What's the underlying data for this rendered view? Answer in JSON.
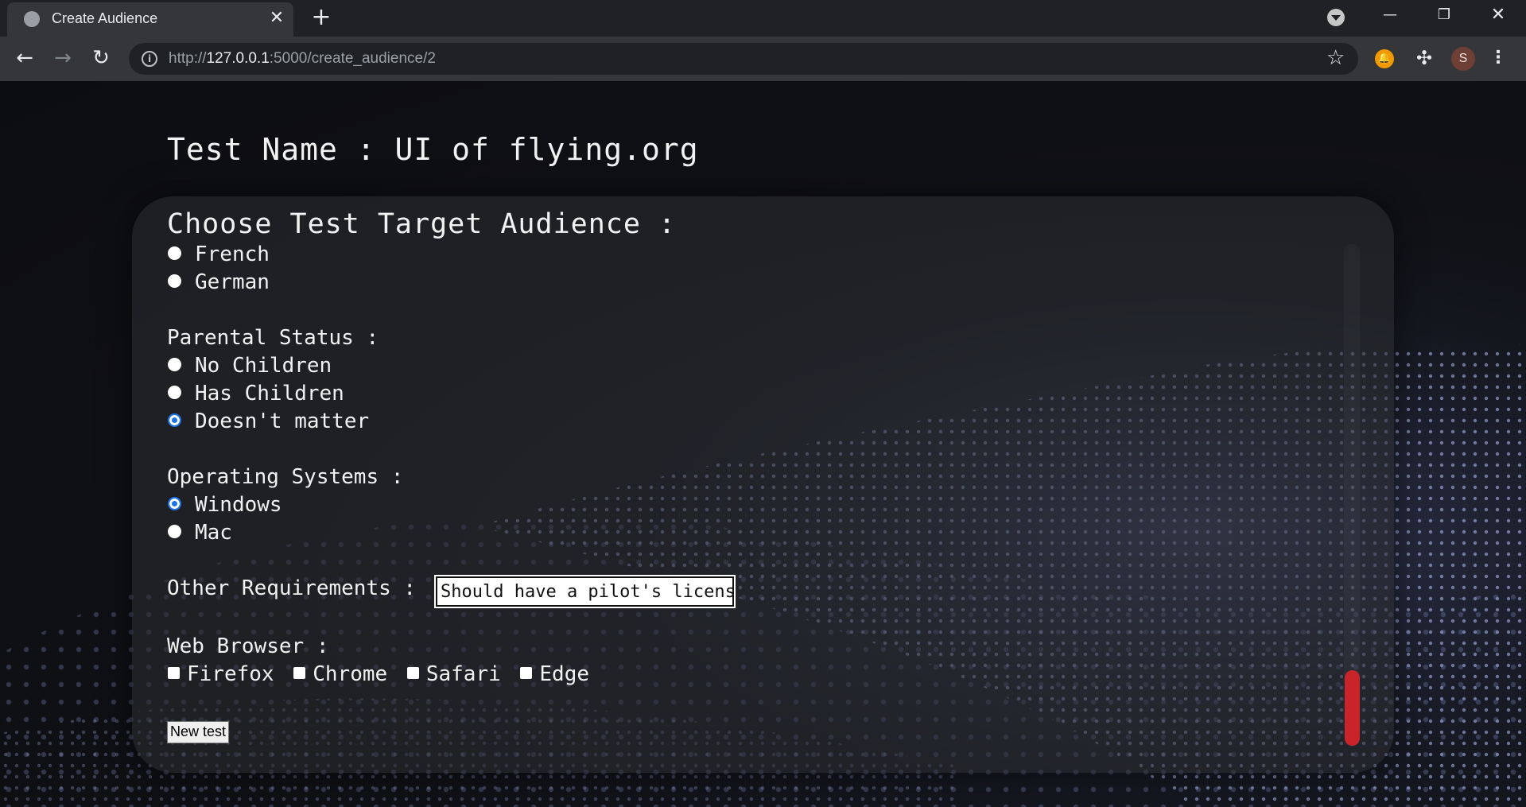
{
  "browser": {
    "tab_title": "Create Audience",
    "url_prefix": "http://",
    "url_host": "127.0.0.1",
    "url_rest": ":5000/create_audience/2",
    "avatar_initial": "S"
  },
  "page": {
    "test_name": "Test Name : UI of flying.org",
    "panel_title": "Choose Test Target Audience :",
    "language_options": [
      {
        "label": "French",
        "checked": false
      },
      {
        "label": "German",
        "checked": false
      }
    ],
    "parental": {
      "label": "Parental Status :",
      "options": [
        {
          "label": "No Children",
          "checked": false
        },
        {
          "label": "Has Children",
          "checked": false
        },
        {
          "label": "Doesn't matter",
          "checked": true
        }
      ]
    },
    "os": {
      "label": "Operating Systems :",
      "options": [
        {
          "label": "Windows",
          "checked": true
        },
        {
          "label": "Mac",
          "checked": false
        }
      ]
    },
    "other": {
      "label": "Other Requirements :",
      "value": "Should have a pilot's license"
    },
    "browsers": {
      "label": "Web Browser :",
      "options": [
        {
          "label": "Firefox",
          "checked": false
        },
        {
          "label": "Chrome",
          "checked": false
        },
        {
          "label": "Safari",
          "checked": false
        },
        {
          "label": "Edge",
          "checked": false
        }
      ]
    },
    "submit_label": "New test"
  },
  "colors": {
    "radio_checked": "#1a73e8",
    "scroll_thumb": "#c8242a"
  }
}
